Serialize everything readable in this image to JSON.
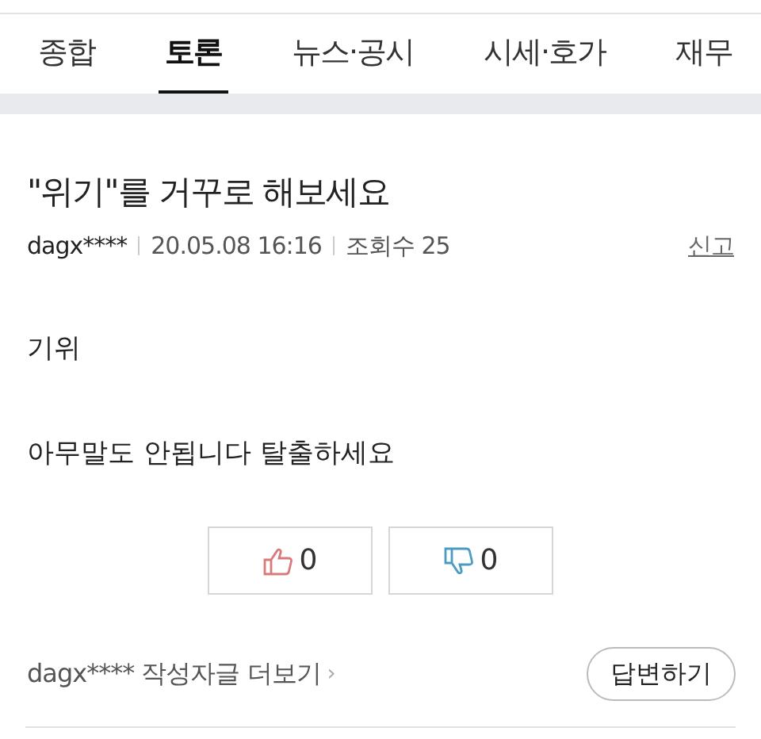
{
  "tabs": [
    {
      "label": "종합",
      "selected": false
    },
    {
      "label": "토론",
      "selected": true
    },
    {
      "label": "뉴스·공시",
      "selected": false
    },
    {
      "label": "시세·호가",
      "selected": false
    },
    {
      "label": "재무",
      "selected": false
    }
  ],
  "post": {
    "title": "\"위기\"를 거꾸로 해보세요",
    "author": "dagx****",
    "date": "20.05.08 16:16",
    "views": "조회수 25",
    "report": "신고",
    "paragraphs": [
      "기위",
      "아무말도 안됩니다 탈출하세요"
    ],
    "likes": "0",
    "dislikes": "0",
    "more_link": "dagx**** 작성자글 더보기",
    "more_chevron": "›",
    "reply_button": "답변하기"
  }
}
